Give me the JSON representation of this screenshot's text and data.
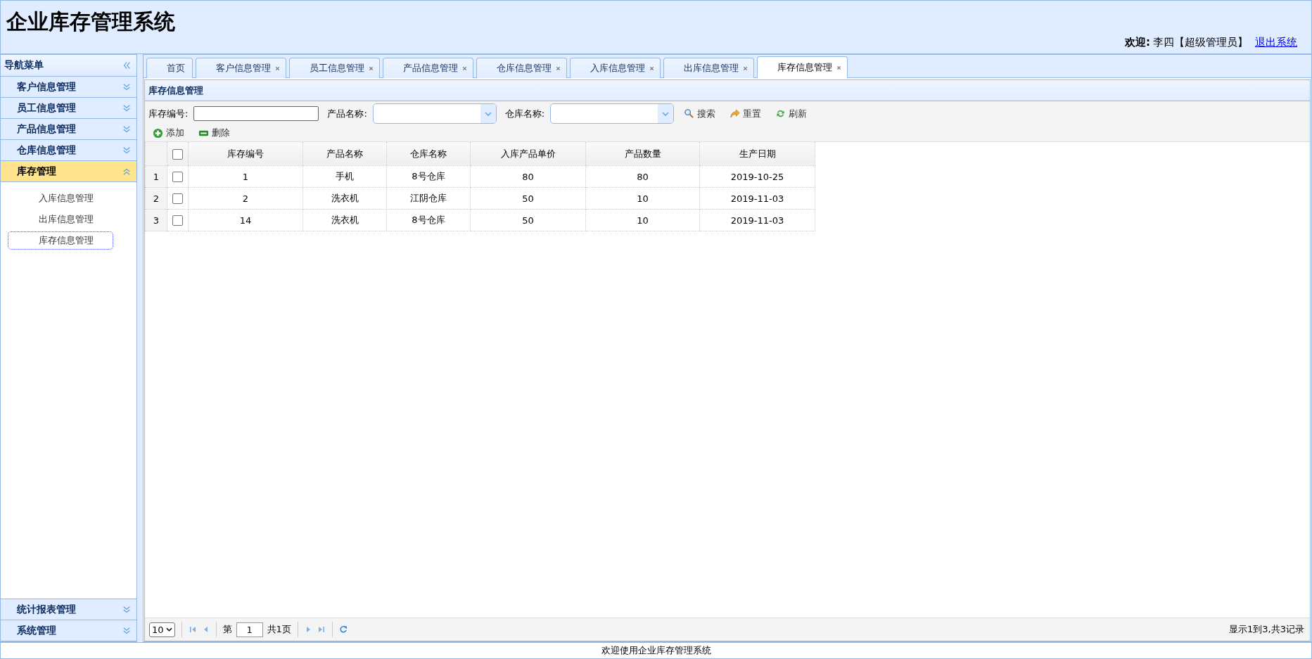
{
  "header": {
    "title": "企业库存管理系统",
    "welcome_label": "欢迎:",
    "user": "李四【超级管理员】",
    "logout_link": "退出系统"
  },
  "sidebar": {
    "title": "导航菜单",
    "sections": [
      {
        "label": "客户信息管理",
        "expanded": false
      },
      {
        "label": "员工信息管理",
        "expanded": false
      },
      {
        "label": "产品信息管理",
        "expanded": false
      },
      {
        "label": "仓库信息管理",
        "expanded": false
      },
      {
        "label": "库存管理",
        "expanded": true,
        "children": [
          {
            "label": "入库信息管理",
            "selected": false
          },
          {
            "label": "出库信息管理",
            "selected": false
          },
          {
            "label": "库存信息管理",
            "selected": true
          }
        ]
      },
      {
        "label": "统计报表管理",
        "expanded": false
      },
      {
        "label": "系统管理",
        "expanded": false
      }
    ]
  },
  "tabs": [
    {
      "label": "首页",
      "closable": false,
      "selected": false
    },
    {
      "label": "客户信息管理",
      "closable": true,
      "selected": false
    },
    {
      "label": "员工信息管理",
      "closable": true,
      "selected": false
    },
    {
      "label": "产品信息管理",
      "closable": true,
      "selected": false
    },
    {
      "label": "仓库信息管理",
      "closable": true,
      "selected": false
    },
    {
      "label": "入库信息管理",
      "closable": true,
      "selected": false
    },
    {
      "label": "出库信息管理",
      "closable": true,
      "selected": false
    },
    {
      "label": "库存信息管理",
      "closable": true,
      "selected": true
    }
  ],
  "panel": {
    "title": "库存信息管理",
    "filters": [
      {
        "kind": "text",
        "label": "库存编号:"
      },
      {
        "kind": "combo",
        "label": "产品名称:"
      },
      {
        "kind": "combo",
        "label": "仓库名称:"
      }
    ],
    "filter_buttons": [
      {
        "kind": "search",
        "label": "搜索"
      },
      {
        "kind": "reset",
        "label": "重置"
      },
      {
        "kind": "refresh",
        "label": "刷新"
      }
    ],
    "actions": [
      {
        "kind": "add",
        "label": "添加"
      },
      {
        "kind": "remove",
        "label": "删除"
      }
    ],
    "table": {
      "select_all_checked": false,
      "columns": [
        "库存编号",
        "产品名称",
        "仓库名称",
        "入库产品单价",
        "产品数量",
        "生产日期"
      ],
      "rows": [
        {
          "row_number": "1",
          "checked": false,
          "cells": [
            "1",
            "手机",
            "8号仓库",
            "80",
            "80",
            "2019-10-25"
          ]
        },
        {
          "row_number": "2",
          "checked": false,
          "cells": [
            "2",
            "洗衣机",
            "江阴仓库",
            "50",
            "10",
            "2019-11-03"
          ]
        },
        {
          "row_number": "3",
          "checked": false,
          "cells": [
            "14",
            "洗衣机",
            "8号仓库",
            "50",
            "10",
            "2019-11-03"
          ]
        }
      ]
    },
    "pager": {
      "page_size": "10",
      "page_prefix": "第",
      "page": "1",
      "page_suffix": "共1页",
      "summary": "显示1到3,共3记录"
    }
  },
  "footer": {
    "text": "欢迎使用企业库存管理系统"
  }
}
